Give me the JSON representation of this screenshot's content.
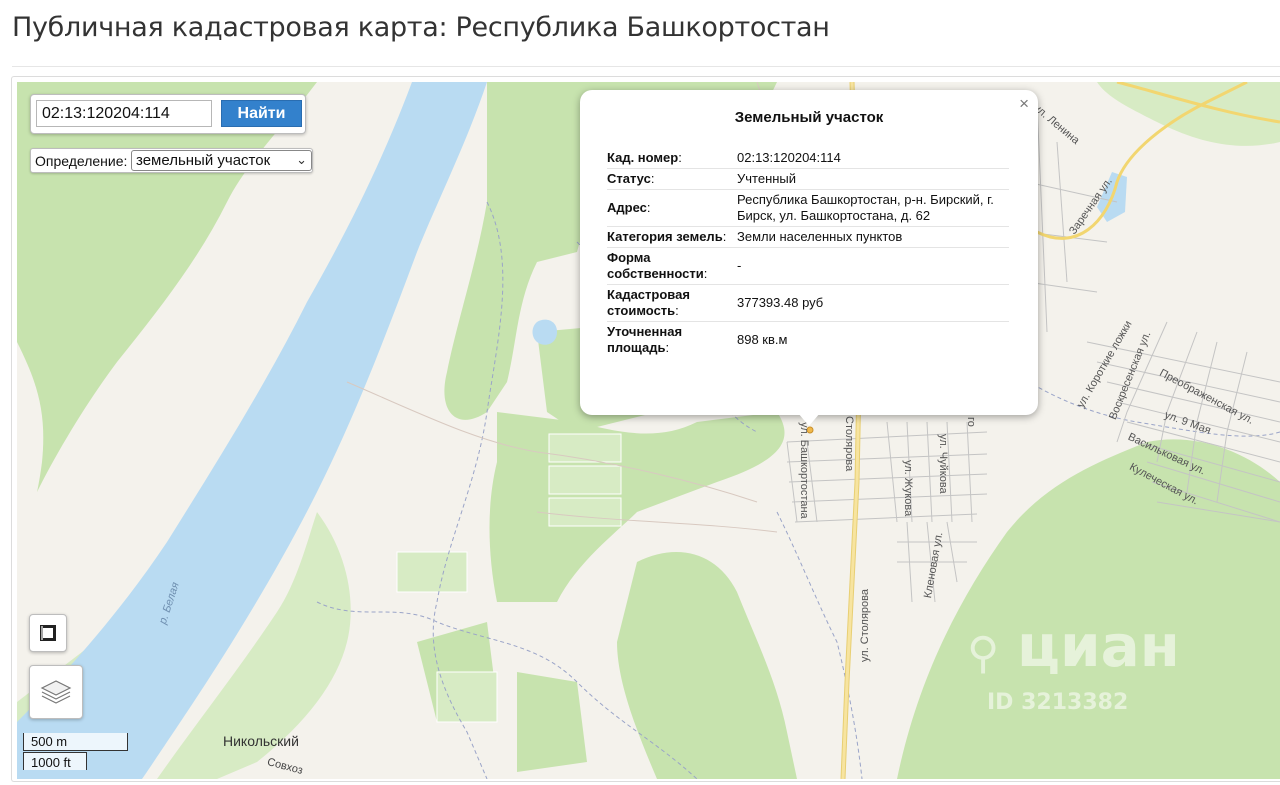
{
  "page": {
    "title": "Публичная кадастровая карта: Республика Башкортостан"
  },
  "search": {
    "value": "02:13:120204:114",
    "button_label": "Найти"
  },
  "definition": {
    "label": "Определение:",
    "selected": "земельный участок"
  },
  "popup": {
    "title": "Земельный участок",
    "close_symbol": "×",
    "rows": [
      {
        "label": "Кад. номер",
        "value": "02:13:120204:114"
      },
      {
        "label": "Статус",
        "value": "Учтенный"
      },
      {
        "label": "Адрес",
        "value": "Республика Башкортостан, р-н. Бирский, г. Бирск, ул. Башкортостана, д. 62"
      },
      {
        "label": "Категория земель",
        "value": "Земли населенных пунктов"
      },
      {
        "label": "Форма собственности",
        "value": "-"
      },
      {
        "label": "Кадастровая стоимость",
        "value": "377393.48 руб"
      },
      {
        "label": "Уточненная площадь",
        "value": "898 кв.м"
      }
    ]
  },
  "scale": {
    "metric": "500 m",
    "imperial": "1000 ft"
  },
  "map_labels": {
    "river": "р. Белая",
    "village": "Никольский",
    "sovkhoz": "Совхоз",
    "street_bashkortostana": "ул. Башкортостана",
    "street_stolyarova_1": "Столярова",
    "street_stolyarova_2": "ул. Столярова",
    "street_zhukova": "ул. Жукова",
    "street_chuikova": "ул. Чуйкова",
    "street_klenovaya": "Кленовая ул.",
    "street_lenina": "ул. Ленина",
    "street_zarechnaya": "Заречная ул.",
    "street_korotkie": "ул. Короткие ложки",
    "street_voskresenskaya": "Воскресенская ул.",
    "street_preobrazhenskaya": "Преображенская ул.",
    "street_9maya": "ул. 9 Мая",
    "street_vasilkovaya": "Васильковая ул.",
    "street_kulecheskaya": "Кулеческая ул.",
    "street_fragment": "го"
  },
  "watermark": {
    "brand": "циан",
    "id": "ID 3213382"
  },
  "colors": {
    "water": "#b9dbf2",
    "forest": "#c7e3ae",
    "forest_light": "#d7ebc4",
    "land": "#f4f2ec",
    "road_major": "#f6dd8a",
    "button": "#3381cc"
  },
  "icons": [
    "fullscreen-icon",
    "layers-icon",
    "close-icon",
    "chevron-down-icon",
    "pin-icon"
  ]
}
